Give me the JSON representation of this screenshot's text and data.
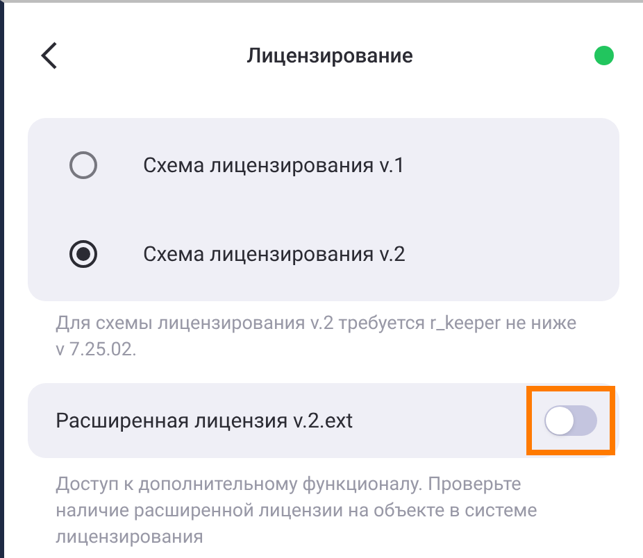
{
  "header": {
    "title": "Лицензирование",
    "color": "#22c55e"
  },
  "schemes": [
    {
      "label": "Схема лицензирования v.1",
      "selected": false
    },
    {
      "label": "Схема лицензирования v.2",
      "selected": true
    }
  ],
  "schemes_note": "Для схемы лицензирования v.2 требуется r_keeper не ниже v 7.25.02.",
  "extended": {
    "label": "Расширенная лицензия v.2.ext",
    "on": false,
    "highlighted": true
  },
  "extended_note": "Доступ к дополнительному функционалу. Проверьте наличие расширенной лицензии на объекте в системе лицензирования"
}
